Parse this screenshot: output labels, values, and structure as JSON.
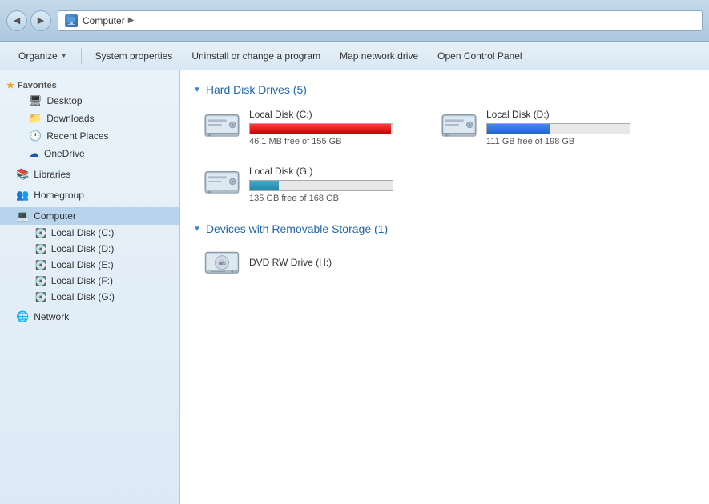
{
  "titlebar": {
    "address": "Computer",
    "arrow": "▶"
  },
  "toolbar": {
    "organize_label": "Organize",
    "system_properties_label": "System properties",
    "uninstall_label": "Uninstall or change a program",
    "map_network_label": "Map network drive",
    "open_control_panel_label": "Open Control Panel"
  },
  "sidebar": {
    "favorites_label": "Favorites",
    "desktop_label": "Desktop",
    "downloads_label": "Downloads",
    "recent_places_label": "Recent Places",
    "onedrive_label": "OneDrive",
    "libraries_label": "Libraries",
    "homegroup_label": "Homegroup",
    "computer_label": "Computer",
    "disk_c_label": "Local Disk (C:)",
    "disk_d_label": "Local Disk (D:)",
    "disk_e_label": "Local Disk (E:)",
    "disk_f_label": "Local Disk (F:)",
    "disk_g_label": "Local Disk (G:)",
    "network_label": "Network"
  },
  "content": {
    "hard_disk_section": "Hard Disk Drives (5)",
    "removable_section": "Devices with Removable Storage (1)",
    "drives": [
      {
        "name": "Local Disk (C:)",
        "free_text": "46.1 MB free of 155 GB",
        "fill_pct": 99,
        "bar_color": "red"
      },
      {
        "name": "Local Disk (D:)",
        "free_text": "111 GB free of 198 GB",
        "fill_pct": 44,
        "bar_color": "blue"
      },
      {
        "name": "Local Disk (G:)",
        "free_text": "135 GB free of 168 GB",
        "fill_pct": 20,
        "bar_color": "teal"
      }
    ],
    "dvd_drive": {
      "name": "DVD RW Drive (H:)"
    }
  }
}
